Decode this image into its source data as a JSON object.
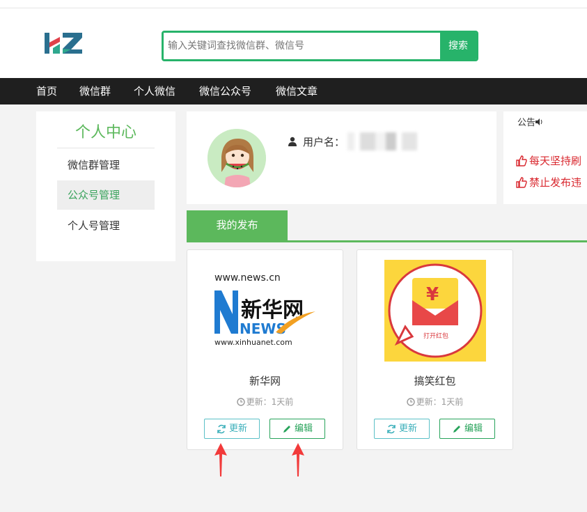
{
  "search": {
    "placeholder": "输入关键词查找微信群、微信号",
    "button_label": "搜索"
  },
  "nav": {
    "items": [
      "首页",
      "微信群",
      "个人微信",
      "微信公众号",
      "微信文章"
    ]
  },
  "sidebar": {
    "title": "个人中心",
    "items": [
      {
        "label": "微信群管理",
        "active": false
      },
      {
        "label": "公众号管理",
        "active": true
      },
      {
        "label": "个人号管理",
        "active": false
      }
    ]
  },
  "profile": {
    "username_label": "用户名："
  },
  "notice": {
    "title": "公告",
    "lines": [
      "每天坚持刷",
      "禁止发布违"
    ]
  },
  "tabs": {
    "my_posts": "我的发布"
  },
  "cards": [
    {
      "name": "新华网",
      "time": "更新：1天前",
      "update_label": "更新",
      "edit_label": "编辑",
      "logo_text": {
        "url": "www.news.cn",
        "cn": "新华网",
        "news": "NEWS",
        "footer": "www.xinhuanet.com"
      }
    },
    {
      "name": "搞笑红包",
      "time": "更新：1天前",
      "update_label": "更新",
      "edit_label": "编辑",
      "logo_text": {
        "cn": "打开红包",
        "currency": "¥"
      }
    }
  ],
  "colors": {
    "brand_green": "#27b36a",
    "tab_green": "#5cb85c",
    "nav_bg": "#1f1f1f",
    "notice_red": "#d9272e",
    "arrow_red": "#f23a3a"
  }
}
